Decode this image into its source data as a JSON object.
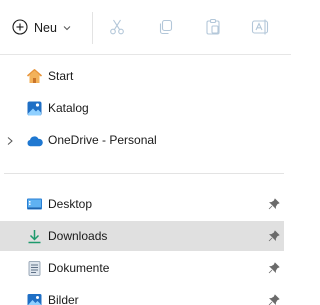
{
  "toolbar": {
    "new_label": "Neu",
    "actions": [
      "cut-icon",
      "copy-icon",
      "paste-icon",
      "rename-icon"
    ]
  },
  "nav": {
    "quick": [
      {
        "label": "Start",
        "icon": "home-icon"
      },
      {
        "label": "Katalog",
        "icon": "gallery-icon"
      },
      {
        "label": "OneDrive - Personal",
        "icon": "onedrive-cloud-icon",
        "expandable": true
      }
    ],
    "pinned": [
      {
        "label": "Desktop",
        "icon": "desktop-icon",
        "pinned": true
      },
      {
        "label": "Downloads",
        "icon": "download-icon",
        "pinned": true,
        "selected": true
      },
      {
        "label": "Dokumente",
        "icon": "documents-icon",
        "pinned": true
      },
      {
        "label": "Bilder",
        "icon": "pictures-icon",
        "pinned": true
      }
    ]
  },
  "colors": {
    "accent": "#0067c0",
    "selected_bg": "#e0e0e0",
    "disabled_icon": "#b3c7d9",
    "home_orange": "#e8953b",
    "download_green": "#1d9a6c"
  }
}
